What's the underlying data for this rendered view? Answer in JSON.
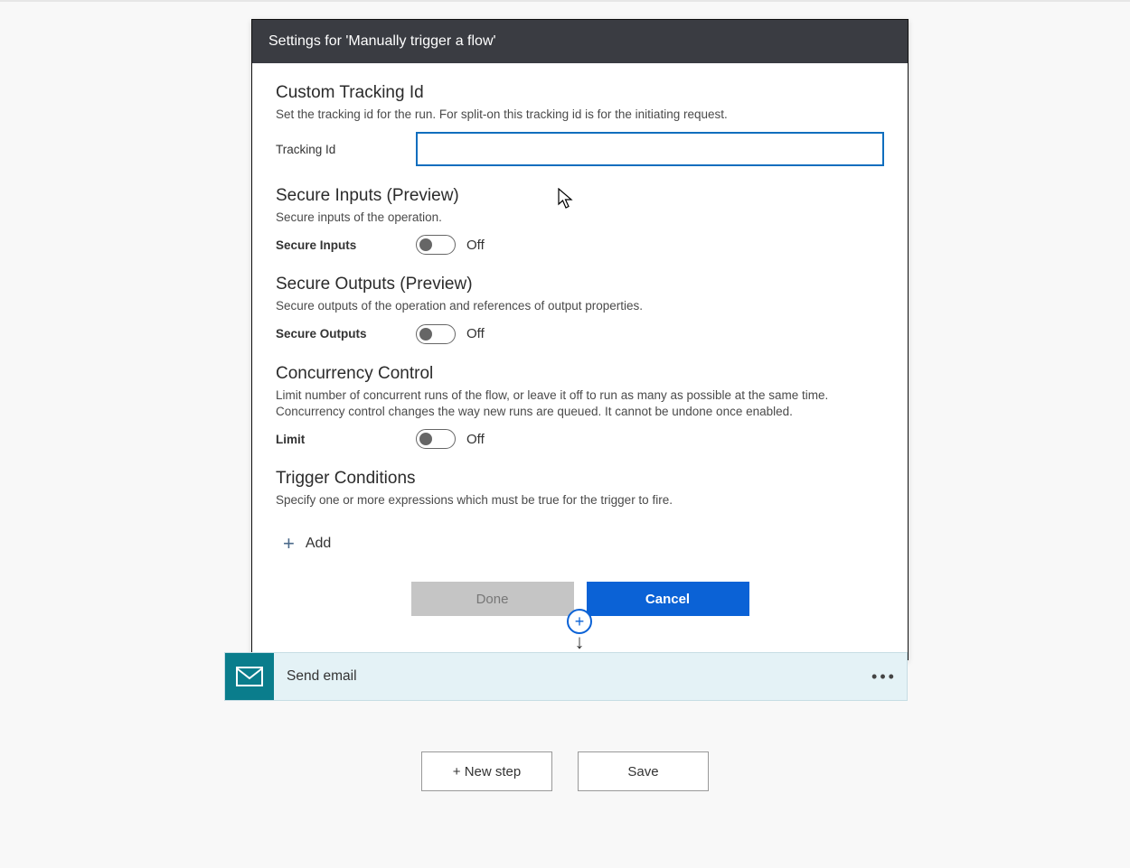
{
  "dialog": {
    "title": "Settings for 'Manually trigger a flow'",
    "tracking": {
      "heading": "Custom Tracking Id",
      "description": "Set the tracking id for the run. For split-on this tracking id is for the initiating request.",
      "label": "Tracking Id",
      "value": ""
    },
    "secureInputs": {
      "heading": "Secure Inputs (Preview)",
      "description": "Secure inputs of the operation.",
      "label": "Secure Inputs",
      "state": "Off"
    },
    "secureOutputs": {
      "heading": "Secure Outputs (Preview)",
      "description": "Secure outputs of the operation and references of output properties.",
      "label": "Secure Outputs",
      "state": "Off"
    },
    "concurrency": {
      "heading": "Concurrency Control",
      "description": "Limit number of concurrent runs of the flow, or leave it off to run as many as possible at the same time. Concurrency control changes the way new runs are queued. It cannot be undone once enabled.",
      "label": "Limit",
      "state": "Off"
    },
    "conditions": {
      "heading": "Trigger Conditions",
      "description": "Specify one or more expressions which must be true for the trigger to fire.",
      "addLabel": "Add"
    },
    "buttons": {
      "done": "Done",
      "cancel": "Cancel"
    }
  },
  "actionCard": {
    "title": "Send email"
  },
  "bottom": {
    "newStep": "+ New step",
    "save": "Save"
  }
}
